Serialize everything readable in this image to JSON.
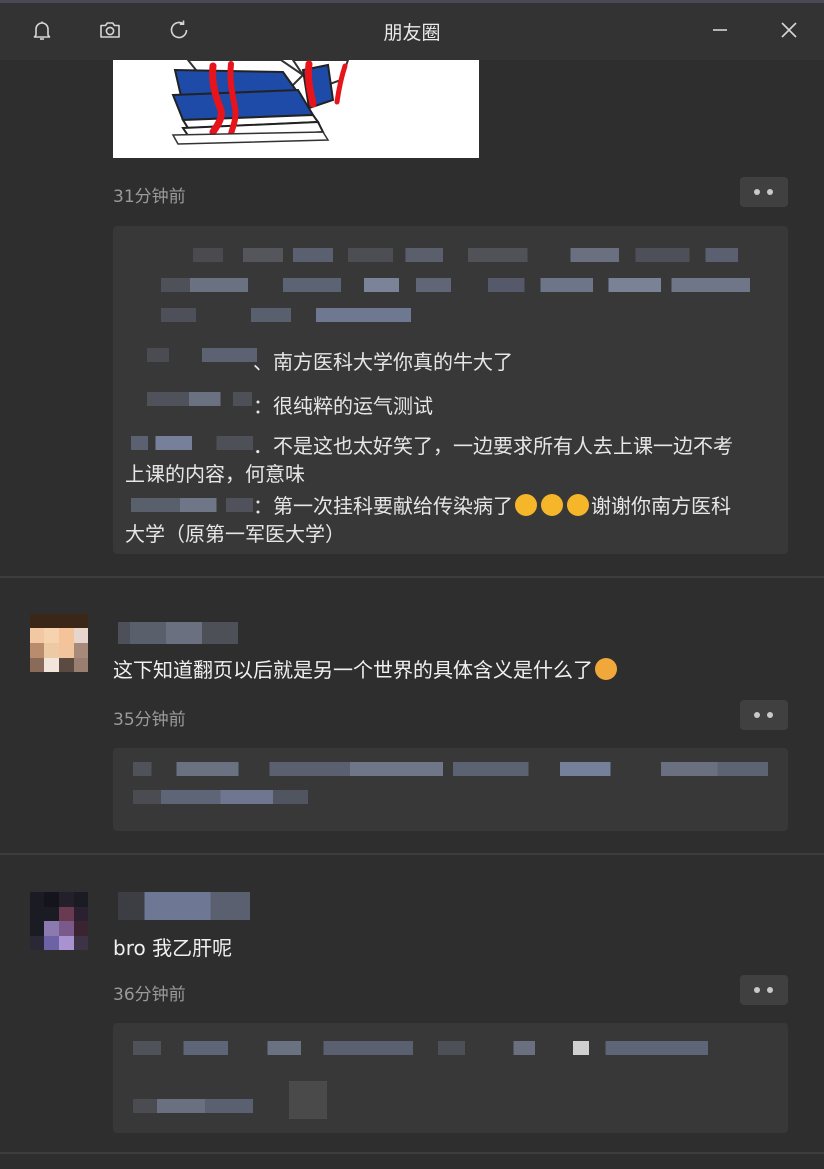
{
  "window": {
    "title": "朋友圈",
    "icons": [
      "bell-icon",
      "camera-icon",
      "refresh-icon",
      "minimize-icon",
      "close-icon"
    ]
  },
  "posts": [
    {
      "time": "31分钟前",
      "comments": [
        {
          "text": "、南方医科大学你真的牛大了"
        },
        {
          "text": "：很纯粹的运气测试"
        },
        {
          "text": "．不是这也太好笑了，一边要求所有人去上课一边不考",
          "cont": "上课的内容，何意味"
        },
        {
          "text": "：第一次挂科要献给传染病了",
          "text2": "谢谢你南方医科",
          "cont": "大学（原第一军医大学）"
        }
      ]
    },
    {
      "body": "这下知道翻页以后就是另一个世界的具体含义是什么了",
      "time": "35分钟前"
    },
    {
      "body": "bro 我乙肝呢",
      "time": "36分钟前"
    }
  ],
  "colors": {
    "background": "#2e2e2e",
    "titlebar": "#333333",
    "comment_box": "#383838",
    "book_blue": "#1e4aa8",
    "red_mark": "#e8141b"
  }
}
